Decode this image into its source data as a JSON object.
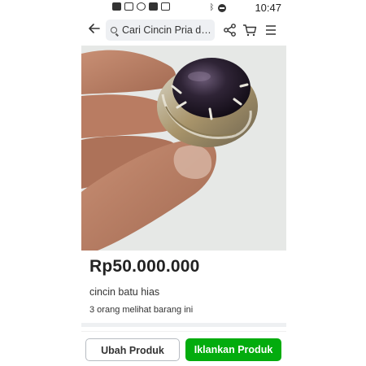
{
  "status_bar": {
    "time": "10:47",
    "left_icons": [
      "video-icon",
      "message-icon",
      "whatsapp-icon",
      "app-icon",
      "chat-icon"
    ],
    "right_icons": [
      "bluetooth-icon",
      "do-not-disturb-icon"
    ]
  },
  "header": {
    "search_text": "Cari Cincin Pria di...",
    "icons": [
      "back-arrow-icon",
      "search-icon",
      "share-icon",
      "cart-icon",
      "menu-icon"
    ]
  },
  "product": {
    "image_description_icon": "product-photo",
    "price": "Rp50.000.000",
    "name": "cincin batu hias",
    "views": "3 orang melihat barang ini"
  },
  "actions": {
    "edit_label": "Ubah Produk",
    "advertise_label": "Iklankan Produk"
  },
  "colors": {
    "primary_green": "#03ac0e",
    "search_bg": "#eef0f3",
    "text": "#222222"
  }
}
